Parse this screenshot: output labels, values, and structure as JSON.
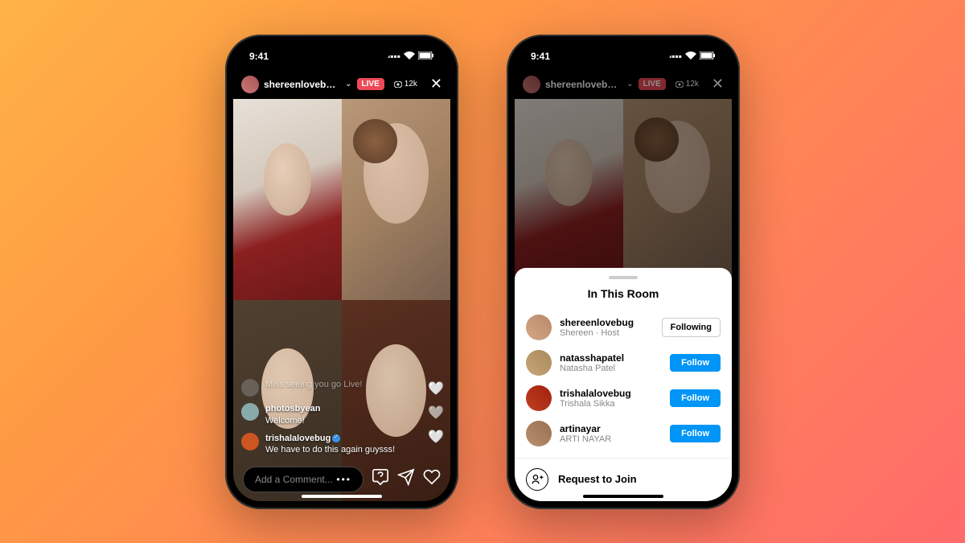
{
  "statusbar": {
    "time": "9:41"
  },
  "header": {
    "username_display": "shereenlovebug, n...",
    "live_label": "LIVE",
    "viewer_count": "12k"
  },
  "comments": [
    {
      "user": "",
      "text": "Miss seeing you go Live!",
      "faded": true
    },
    {
      "user": "photosbyean",
      "text": "Welcome!"
    },
    {
      "user": "trishalalovebug",
      "text": "We have to do this again guysss!",
      "verified": true
    }
  ],
  "comment_input": {
    "placeholder": "Add a Comment..."
  },
  "sheet": {
    "title": "In This Room",
    "members": [
      {
        "username": "shereenlovebug",
        "subtitle": "Shereen · Host",
        "button": "Following",
        "following": true
      },
      {
        "username": "natasshapatel",
        "subtitle": "Natasha Patel",
        "button": "Follow",
        "following": false
      },
      {
        "username": "trishalalovebug",
        "subtitle": "Trishala Sikka",
        "button": "Follow",
        "following": false
      },
      {
        "username": "artinayar",
        "subtitle": "ARTI NAYAR",
        "button": "Follow",
        "following": false
      }
    ],
    "request_label": "Request to Join"
  }
}
